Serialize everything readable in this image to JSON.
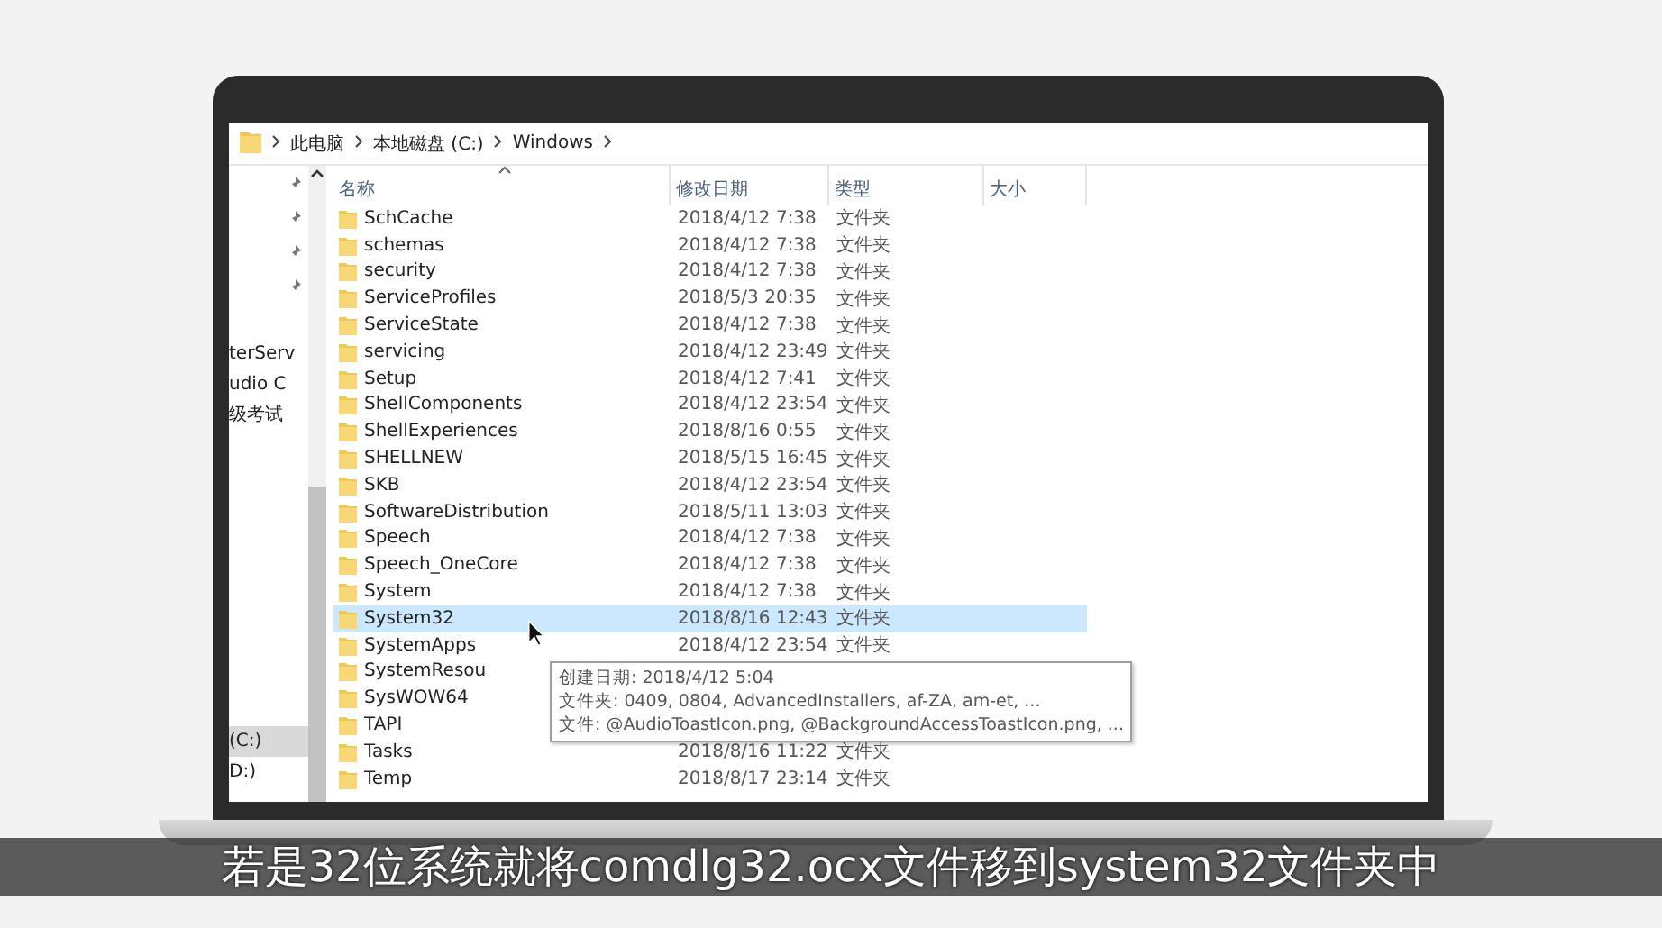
{
  "address_bar": {
    "crumbs": [
      "此电脑",
      "本地磁盘 (C:)",
      "Windows"
    ]
  },
  "nav_pane": {
    "quick_access": [
      {
        "label": "terServ",
        "selected": false
      },
      {
        "label": "udio C",
        "selected": false
      },
      {
        "label": "级考试",
        "selected": false
      }
    ],
    "drives": [
      {
        "label": "(C:)",
        "selected": true
      },
      {
        "label": "D:)",
        "selected": false
      }
    ]
  },
  "columns": [
    {
      "label": "名称",
      "sorted": true
    },
    {
      "label": "修改日期",
      "sorted": false
    },
    {
      "label": "类型",
      "sorted": false
    },
    {
      "label": "大小",
      "sorted": false
    }
  ],
  "rows": [
    {
      "name": "SchCache",
      "date": "2018/4/12 7:38",
      "type": "文件夹",
      "selected": false
    },
    {
      "name": "schemas",
      "date": "2018/4/12 7:38",
      "type": "文件夹",
      "selected": false
    },
    {
      "name": "security",
      "date": "2018/4/12 7:38",
      "type": "文件夹",
      "selected": false
    },
    {
      "name": "ServiceProfiles",
      "date": "2018/5/3 20:35",
      "type": "文件夹",
      "selected": false
    },
    {
      "name": "ServiceState",
      "date": "2018/4/12 7:38",
      "type": "文件夹",
      "selected": false
    },
    {
      "name": "servicing",
      "date": "2018/4/12 23:49",
      "type": "文件夹",
      "selected": false
    },
    {
      "name": "Setup",
      "date": "2018/4/12 7:41",
      "type": "文件夹",
      "selected": false
    },
    {
      "name": "ShellComponents",
      "date": "2018/4/12 23:54",
      "type": "文件夹",
      "selected": false
    },
    {
      "name": "ShellExperiences",
      "date": "2018/8/16 0:55",
      "type": "文件夹",
      "selected": false
    },
    {
      "name": "SHELLNEW",
      "date": "2018/5/15 16:45",
      "type": "文件夹",
      "selected": false
    },
    {
      "name": "SKB",
      "date": "2018/4/12 23:54",
      "type": "文件夹",
      "selected": false
    },
    {
      "name": "SoftwareDistribution",
      "date": "2018/5/11 13:03",
      "type": "文件夹",
      "selected": false
    },
    {
      "name": "Speech",
      "date": "2018/4/12 7:38",
      "type": "文件夹",
      "selected": false
    },
    {
      "name": "Speech_OneCore",
      "date": "2018/4/12 7:38",
      "type": "文件夹",
      "selected": false
    },
    {
      "name": "System",
      "date": "2018/4/12 7:38",
      "type": "文件夹",
      "selected": false
    },
    {
      "name": "System32",
      "date": "2018/8/16 12:43",
      "type": "文件夹",
      "selected": true
    },
    {
      "name": "SystemApps",
      "date": "2018/4/12 23:54",
      "type": "文件夹",
      "selected": false
    },
    {
      "name": "SystemResou",
      "selected": false
    },
    {
      "name": "SysWOW64",
      "selected": false
    },
    {
      "name": "TAPI",
      "selected": false
    },
    {
      "name": "Tasks",
      "date": "2018/8/16 11:22",
      "type": "文件夹",
      "selected": false
    },
    {
      "name": "Temp",
      "date": "2018/8/17 23:14",
      "type": "文件夹",
      "selected": false
    }
  ],
  "tooltip": {
    "lines": [
      "创建日期: 2018/4/12 5:04",
      "文件夹: 0409, 0804, AdvancedInstallers, af-ZA, am-et, ...",
      "文件: @AudioToastIcon.png, @BackgroundAccessToastIcon.png, ..."
    ]
  },
  "subtitle": "若是32位系统就将comdlg32.ocx文件移到system32文件夹中"
}
